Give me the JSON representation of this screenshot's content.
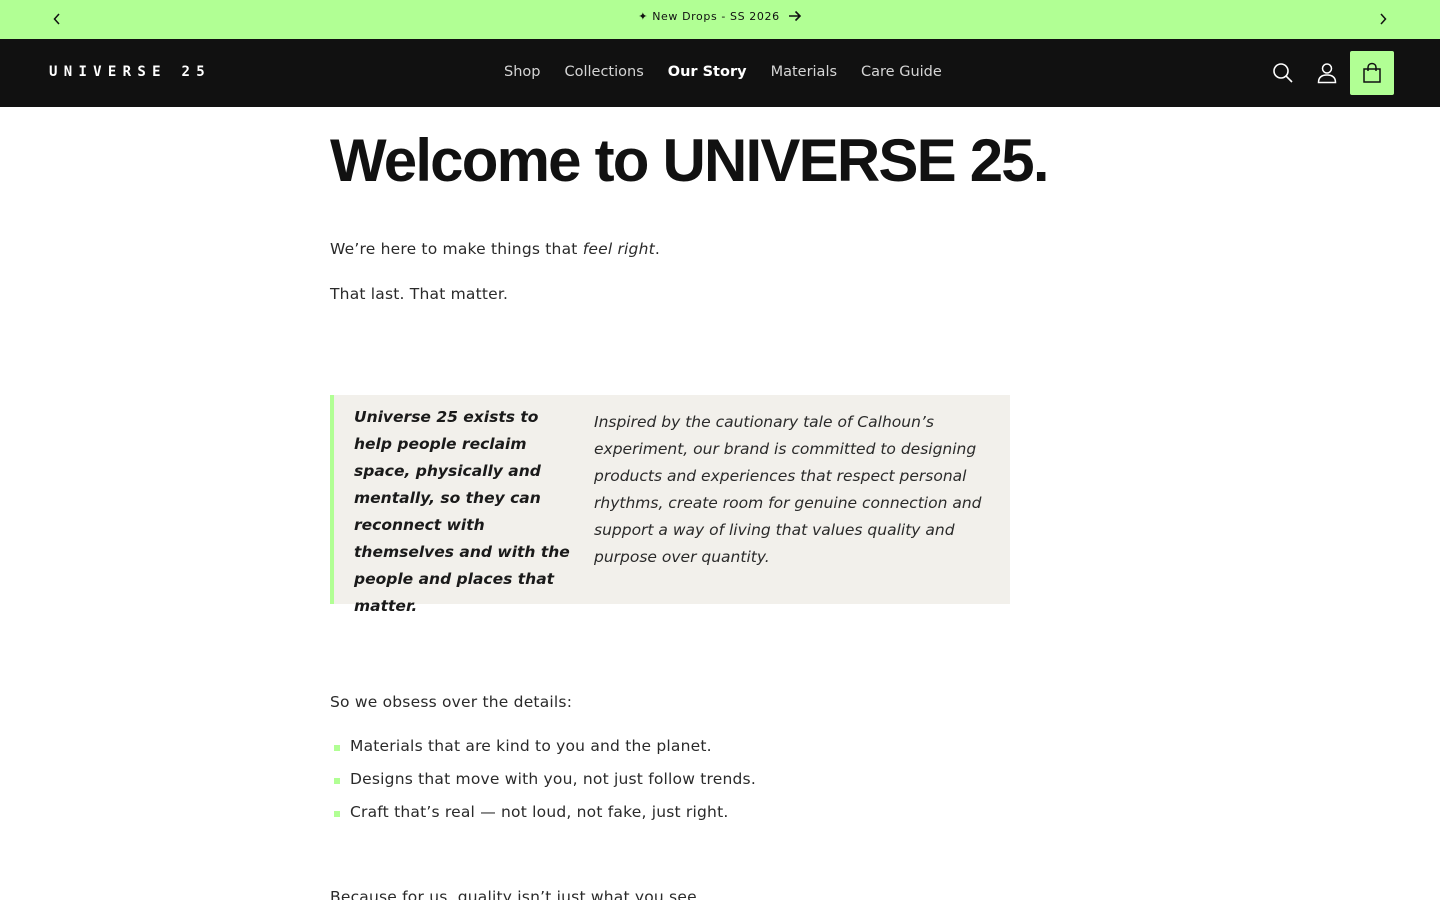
{
  "announcement": {
    "text": "✦ New Drops - SS 2026",
    "prev_icon": "chevron-left-icon",
    "next_icon": "chevron-right-icon",
    "arrow_icon": "arrow-right-icon",
    "background_color": "#b1ff94"
  },
  "header": {
    "logo": "UNIVERSE 25",
    "nav": [
      {
        "label": "Shop",
        "active": false
      },
      {
        "label": "Collections",
        "active": false
      },
      {
        "label": "Our Story",
        "active": true
      },
      {
        "label": "Materials",
        "active": false
      },
      {
        "label": "Care Guide",
        "active": false
      }
    ],
    "icons": [
      "search-icon",
      "account-icon",
      "cart-icon"
    ],
    "background_color": "#111111",
    "accent_color": "#b1ff94"
  },
  "main": {
    "title": "Welcome to UNIVERSE 25.",
    "intro_prefix": "We’re here to make things that ",
    "intro_emphasis": "feel right",
    "intro_suffix": ".",
    "intro_line2": "That last. That matter.",
    "quote_lead": "Universe 25 exists to help people reclaim space, physically and mentally, so they can reconnect with themselves and with the people and places that matter.",
    "quote_body": "Inspired by the cautionary tale of Calhoun’s experiment, our brand is committed to designing products and experiences that respect personal rhythms, create room for genuine connection and support a way of living that values quality and purpose over quantity.",
    "details_intro": "So we obsess over the details:",
    "details": [
      "Materials that are kind to you and the planet.",
      "Designs that move with you, not just follow trends.",
      "Craft that’s real — not loud, not fake, just right."
    ],
    "next_line": "Because for us, quality isn’t just what you see"
  }
}
